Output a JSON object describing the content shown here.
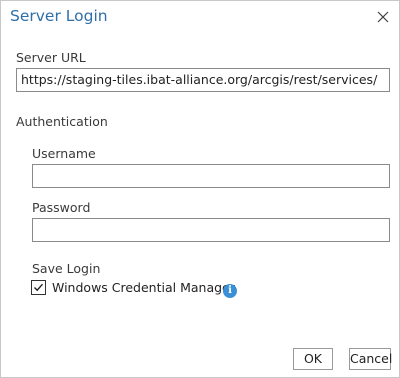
{
  "dialog": {
    "title": "Server Login",
    "close_icon": "close-icon"
  },
  "server": {
    "label": "Server URL",
    "value": "https://staging-tiles.ibat-alliance.org/arcgis/rest/services/"
  },
  "auth": {
    "section_label": "Authentication",
    "username_label": "Username",
    "username_value": "",
    "password_label": "Password",
    "password_value": ""
  },
  "save_login": {
    "label": "Save Login",
    "option_label": "Windows Credential Manager",
    "checked": true,
    "info_icon": "info-icon"
  },
  "buttons": {
    "ok": "OK",
    "cancel": "Cancel"
  },
  "colors": {
    "title": "#2f6fa8",
    "info": "#3a8fd6"
  }
}
